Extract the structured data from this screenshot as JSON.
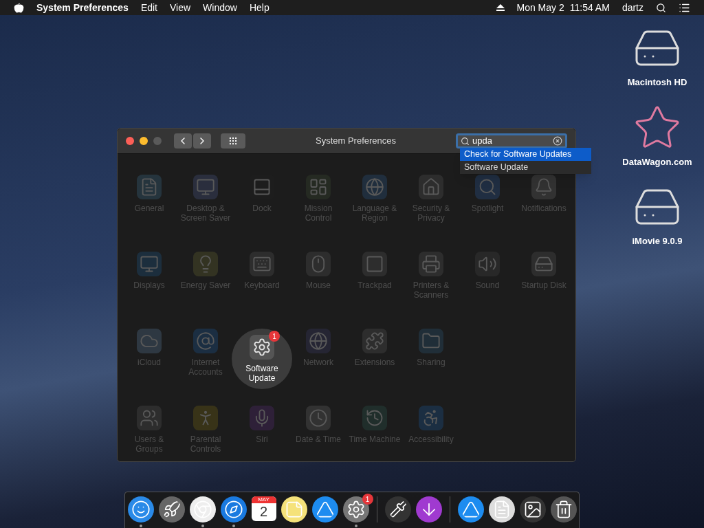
{
  "menu_bar": {
    "app_name": "System Preferences",
    "menus": [
      "Edit",
      "View",
      "Window",
      "Help"
    ],
    "date": "Mon May 2",
    "time": "11:54 AM",
    "user": "dartz"
  },
  "desktop_icons": [
    {
      "kind": "disk",
      "label": "Macintosh HD"
    },
    {
      "kind": "star",
      "label": "DataWagon.com"
    },
    {
      "kind": "drive",
      "label": "iMovie 9.0.9"
    }
  ],
  "window": {
    "title": "System Preferences",
    "search": {
      "value": "upda",
      "results": [
        {
          "label": "Check for Software Updates",
          "selected": true
        },
        {
          "label": "Software Update",
          "selected": false
        }
      ]
    },
    "pane_rows": [
      [
        {
          "kind": "general",
          "label": "General",
          "highlighted": false
        },
        {
          "kind": "desktop",
          "label": "Desktop & Screen Saver",
          "highlighted": false
        },
        {
          "kind": "dock",
          "label": "Dock",
          "highlighted": false
        },
        {
          "kind": "mission",
          "label": "Mission Control",
          "highlighted": false
        },
        {
          "kind": "language",
          "label": "Language & Region",
          "highlighted": false
        },
        {
          "kind": "security",
          "label": "Security & Privacy",
          "highlighted": false
        },
        {
          "kind": "spotlight",
          "label": "Spotlight",
          "highlighted": false
        },
        {
          "kind": "notifications",
          "label": "Notifications",
          "highlighted": false
        }
      ],
      [
        {
          "kind": "displays",
          "label": "Displays",
          "highlighted": false
        },
        {
          "kind": "energy",
          "label": "Energy Saver",
          "highlighted": false
        },
        {
          "kind": "keyboard",
          "label": "Keyboard",
          "highlighted": false
        },
        {
          "kind": "mouse",
          "label": "Mouse",
          "highlighted": false
        },
        {
          "kind": "trackpad",
          "label": "Trackpad",
          "highlighted": false
        },
        {
          "kind": "printers",
          "label": "Printers & Scanners",
          "highlighted": false
        },
        {
          "kind": "sound",
          "label": "Sound",
          "highlighted": false
        },
        {
          "kind": "startup",
          "label": "Startup Disk",
          "highlighted": false
        }
      ],
      [
        {
          "kind": "icloud",
          "label": "iCloud",
          "highlighted": false
        },
        {
          "kind": "accounts",
          "label": "Internet Accounts",
          "highlighted": false
        },
        {
          "kind": "update",
          "label": "Software Update",
          "highlighted": true,
          "badge": "1"
        },
        {
          "kind": "network",
          "label": "Network",
          "highlighted": false
        },
        {
          "kind": "extensions",
          "label": "Extensions",
          "highlighted": false
        },
        {
          "kind": "sharing",
          "label": "Sharing",
          "highlighted": false
        }
      ],
      [
        {
          "kind": "users",
          "label": "Users & Groups",
          "highlighted": false
        },
        {
          "kind": "parental",
          "label": "Parental Controls",
          "highlighted": false
        },
        {
          "kind": "siri",
          "label": "Siri",
          "highlighted": false
        },
        {
          "kind": "datetime",
          "label": "Date & Time",
          "highlighted": false
        },
        {
          "kind": "timemachine",
          "label": "Time Machine",
          "highlighted": false
        },
        {
          "kind": "accessibility",
          "label": "Accessibility",
          "highlighted": false
        }
      ]
    ]
  },
  "dock": [
    {
      "kind": "finder",
      "running": true
    },
    {
      "kind": "launchpad",
      "running": false
    },
    {
      "kind": "chrome",
      "running": true
    },
    {
      "kind": "safari",
      "running": true
    },
    {
      "kind": "calendar",
      "running": false,
      "month": "MAY",
      "day": "2"
    },
    {
      "kind": "notes",
      "running": false
    },
    {
      "kind": "appstore",
      "running": false
    },
    {
      "kind": "preferences",
      "running": true,
      "badge": "1"
    },
    {
      "kind": "separator"
    },
    {
      "kind": "colorpicker",
      "running": false
    },
    {
      "kind": "installer",
      "running": false
    },
    {
      "kind": "separator"
    },
    {
      "kind": "appstore",
      "running": false
    },
    {
      "kind": "document",
      "running": false
    },
    {
      "kind": "screenshot",
      "running": false
    },
    {
      "kind": "trash",
      "running": false
    }
  ]
}
